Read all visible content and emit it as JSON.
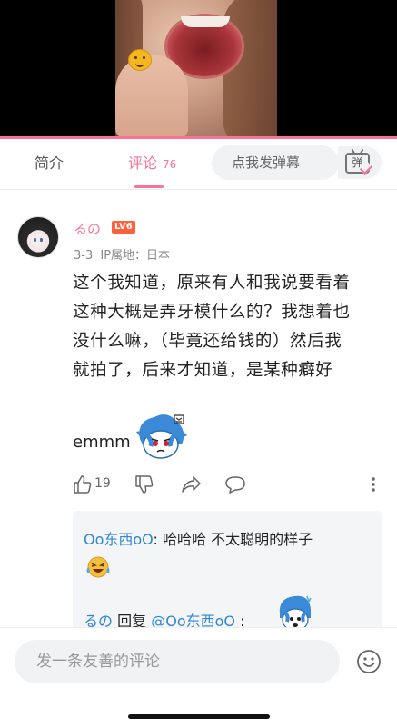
{
  "video": {
    "progress": 1.0
  },
  "tabs": {
    "intro_label": "简介",
    "comments_label": "评论",
    "comments_count": "76",
    "danmaku_placeholder": "点我发弹幕",
    "danmaku_icon_glyph": "弹"
  },
  "comment": {
    "username": "るの",
    "level": "LV6",
    "date": "3-3",
    "ip_location": "IP属地：日本",
    "body_lines": [
      "这个我知道，原来有人和我说要看着",
      "这种大概是弄牙模什么的？我想着也",
      "没什么嘛，（毕竟还给钱的）然后我",
      "就拍了，后来才知道，是某种癖好"
    ],
    "emmm": "emmm",
    "like_count": "19"
  },
  "replies": {
    "first_user": "Oo东西oO",
    "first_text": "哈哈哈 不太聪明的样子",
    "second_user": "るの",
    "second_reply_word": "回复",
    "second_mention": "@Oo东西oO",
    "second_suffix": ":"
  },
  "bottom": {
    "placeholder": "发一条友善的评论"
  },
  "colors": {
    "accent": "#fb7299",
    "link": "#2f86d6",
    "level_badge": "#ff5f3a"
  }
}
